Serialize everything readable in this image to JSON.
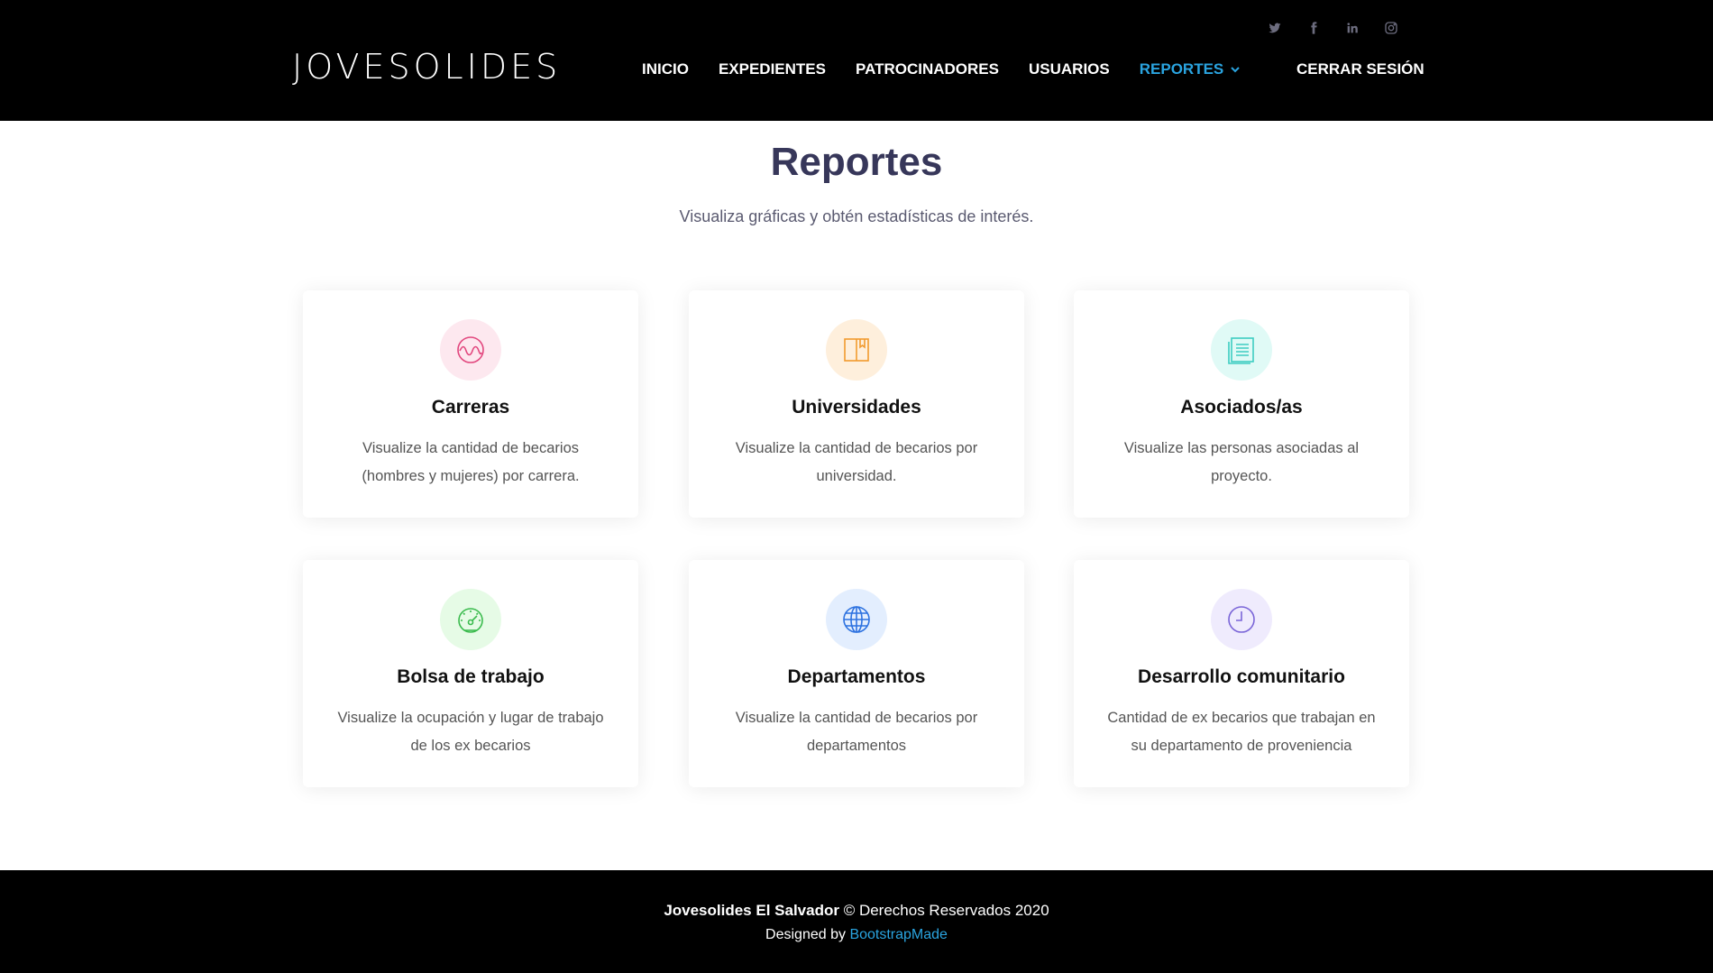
{
  "header": {
    "logo": "JOVESOLIDES",
    "nav": [
      "INICIO",
      "EXPEDIENTES",
      "PATROCINADORES",
      "USUARIOS",
      "REPORTES"
    ],
    "logout": "CERRAR SESIÓN",
    "social_icons": [
      "twitter-icon",
      "facebook-icon",
      "linkedin-icon",
      "instagram-icon"
    ],
    "accent_color": "#2aa4e0"
  },
  "section": {
    "title": "Reportes",
    "subtitle": "Visualiza gráficas y obtén estadísticas de interés."
  },
  "cards": [
    {
      "title": "Carreras",
      "description": "Visualize la cantidad de becarios (hombres y mujeres) por carrera.",
      "icon": "activity-wave-icon",
      "icon_color": "#e2477e",
      "icon_bg": "#fde8ef"
    },
    {
      "title": "Universidades",
      "description": "Visualize la cantidad de becarios por universidad.",
      "icon": "book-icon",
      "icon_color": "#f29a2e",
      "icon_bg": "#feefdc"
    },
    {
      "title": "Asociados/as",
      "description": "Visualize las personas asociadas al proyecto.",
      "icon": "document-list-icon",
      "icon_color": "#3dcdc2",
      "icon_bg": "#e0faf6"
    },
    {
      "title": "Bolsa de trabajo",
      "description": "Visualize la ocupación y lugar de trabajo de los ex becarios",
      "icon": "speedometer-icon",
      "icon_color": "#3bbb4e",
      "icon_bg": "#e6fbe6"
    },
    {
      "title": "Departamentos",
      "description": "Visualize la cantidad de becarios por departamentos",
      "icon": "globe-icon",
      "icon_color": "#2d72e0",
      "icon_bg": "#e3eefe"
    },
    {
      "title": "Desarrollo comunitario",
      "description": "Cantidad de ex becarios que trabajan en su departamento de proveniencia",
      "icon": "clock-icon",
      "icon_color": "#7a65d8",
      "icon_bg": "#efebfd"
    }
  ],
  "footer": {
    "brand": "Jovesolides El Salvador",
    "rights": " © Derechos Reservados 2020",
    "designed_by": "Designed by ",
    "designer": "BootstrapMade"
  }
}
